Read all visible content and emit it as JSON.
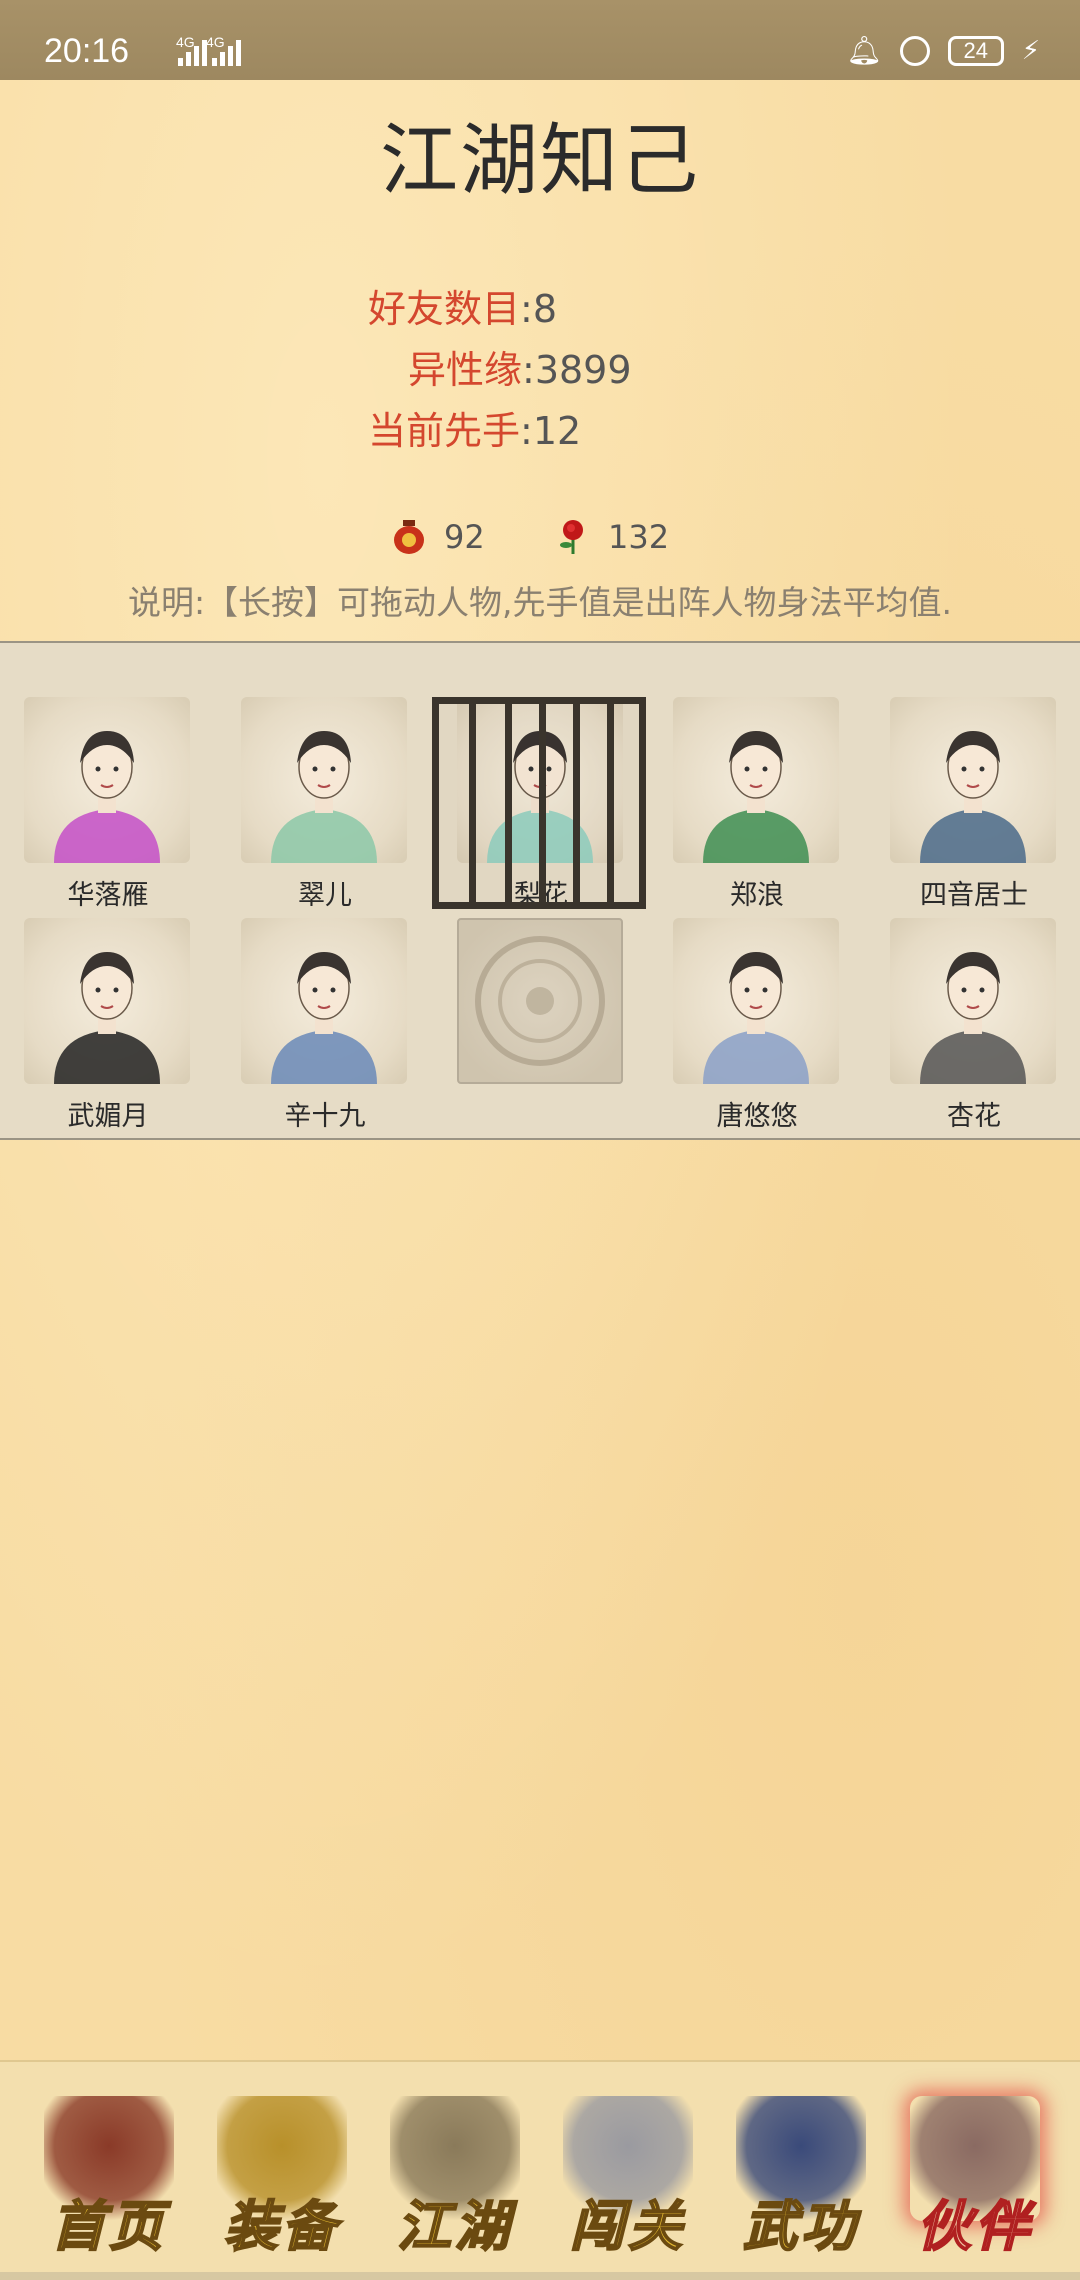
{
  "status_bar": {
    "time": "20:16",
    "sim1": "4G",
    "sim2": "4G",
    "battery": "24"
  },
  "page": {
    "title": "江湖知己"
  },
  "stats": [
    {
      "label": "好友数目",
      "sep": ":",
      "value": "8"
    },
    {
      "label": "异性缘",
      "sep": ":",
      "value": "3899"
    },
    {
      "label": "当前先手",
      "sep": ":",
      "value": "12"
    }
  ],
  "inventory": {
    "wine_icon": "wine-jar-icon",
    "wine_count": "92",
    "rose_icon": "rose-icon",
    "rose_count": "132"
  },
  "note": "说明:【长按】可拖动人物,先手值是出阵人物身法平均值.",
  "companions": [
    {
      "name": "华落雁",
      "icon": "companion-portrait",
      "color": "#c44fc8"
    },
    {
      "name": "翠儿",
      "icon": "companion-portrait",
      "color": "#8cc8a8"
    },
    {
      "name": "梨花",
      "icon": "companion-portrait",
      "color": "#8fd0c0",
      "jailed": true
    },
    {
      "name": "郑浪",
      "icon": "companion-portrait",
      "color": "#3e8e52"
    },
    {
      "name": "四音居士",
      "icon": "companion-portrait",
      "color": "#4a6a8a"
    },
    {
      "name": "武媚月",
      "icon": "companion-portrait",
      "color": "#222222"
    },
    {
      "name": "辛十九",
      "icon": "companion-portrait",
      "color": "#6a8ab8"
    },
    {
      "name": "",
      "icon": "empty-slot-emblem",
      "color": "#cfc4ae"
    },
    {
      "name": "唐悠悠",
      "icon": "companion-portrait",
      "color": "#8aa0c8"
    },
    {
      "name": "杏花",
      "icon": "companion-portrait",
      "color": "#555555"
    }
  ],
  "bottom_nav": [
    {
      "label": "首页",
      "icon": "house-icon",
      "active": false
    },
    {
      "label": "装备",
      "icon": "armor-icon",
      "active": false
    },
    {
      "label": "江湖",
      "icon": "scroll-map-icon",
      "active": false
    },
    {
      "label": "闯关",
      "icon": "crossed-swords-icon",
      "active": false
    },
    {
      "label": "武功",
      "icon": "martial-book-icon",
      "active": false
    },
    {
      "label": "伙伴",
      "icon": "partners-icon",
      "active": true
    }
  ]
}
